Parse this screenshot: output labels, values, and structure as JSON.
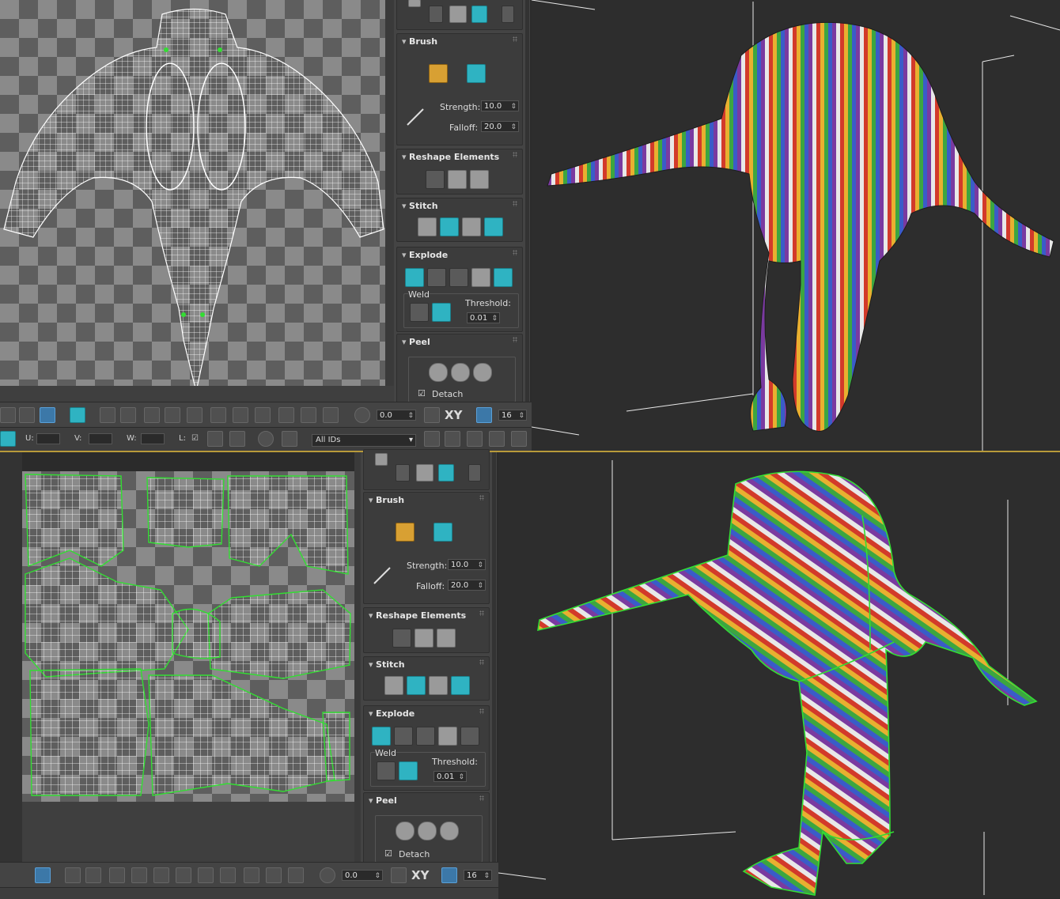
{
  "panels": [
    {
      "id": "top",
      "rollouts": {
        "brush": {
          "title": "Brush",
          "strength_label": "Strength:",
          "strength": "10.0",
          "falloff_label": "Falloff:",
          "falloff": "20.0"
        },
        "reshape": {
          "title": "Reshape Elements"
        },
        "stitch": {
          "title": "Stitch"
        },
        "explode": {
          "title": "Explode",
          "weld_label": "Weld",
          "threshold_label": "Threshold:",
          "threshold": "0.01"
        },
        "peel": {
          "title": "Peel",
          "detach_label": "Detach"
        }
      },
      "toolbar": {
        "angle": "0.0",
        "axis": "XY",
        "grid": "16"
      },
      "statusbar": {
        "u_label": "U:",
        "v_label": "V:",
        "w_label": "W:",
        "l_label": "L:",
        "ids_select": "All IDs"
      }
    },
    {
      "id": "bottom",
      "rollouts": {
        "brush": {
          "title": "Brush",
          "strength_label": "Strength:",
          "strength": "10.0",
          "falloff_label": "Falloff:",
          "falloff": "20.0"
        },
        "reshape": {
          "title": "Reshape Elements"
        },
        "stitch": {
          "title": "Stitch"
        },
        "explode": {
          "title": "Explode",
          "weld_label": "Weld",
          "threshold_label": "Threshold:",
          "threshold": "0.01"
        },
        "peel": {
          "title": "Peel",
          "detach_label": "Detach"
        }
      },
      "toolbar": {
        "angle": "0.0",
        "axis": "XY",
        "grid": "16"
      }
    }
  ],
  "colors": {
    "seam": "#33dd33",
    "accent": "#2fb3c2",
    "divider": "#b89a3a",
    "panel": "#444444"
  }
}
